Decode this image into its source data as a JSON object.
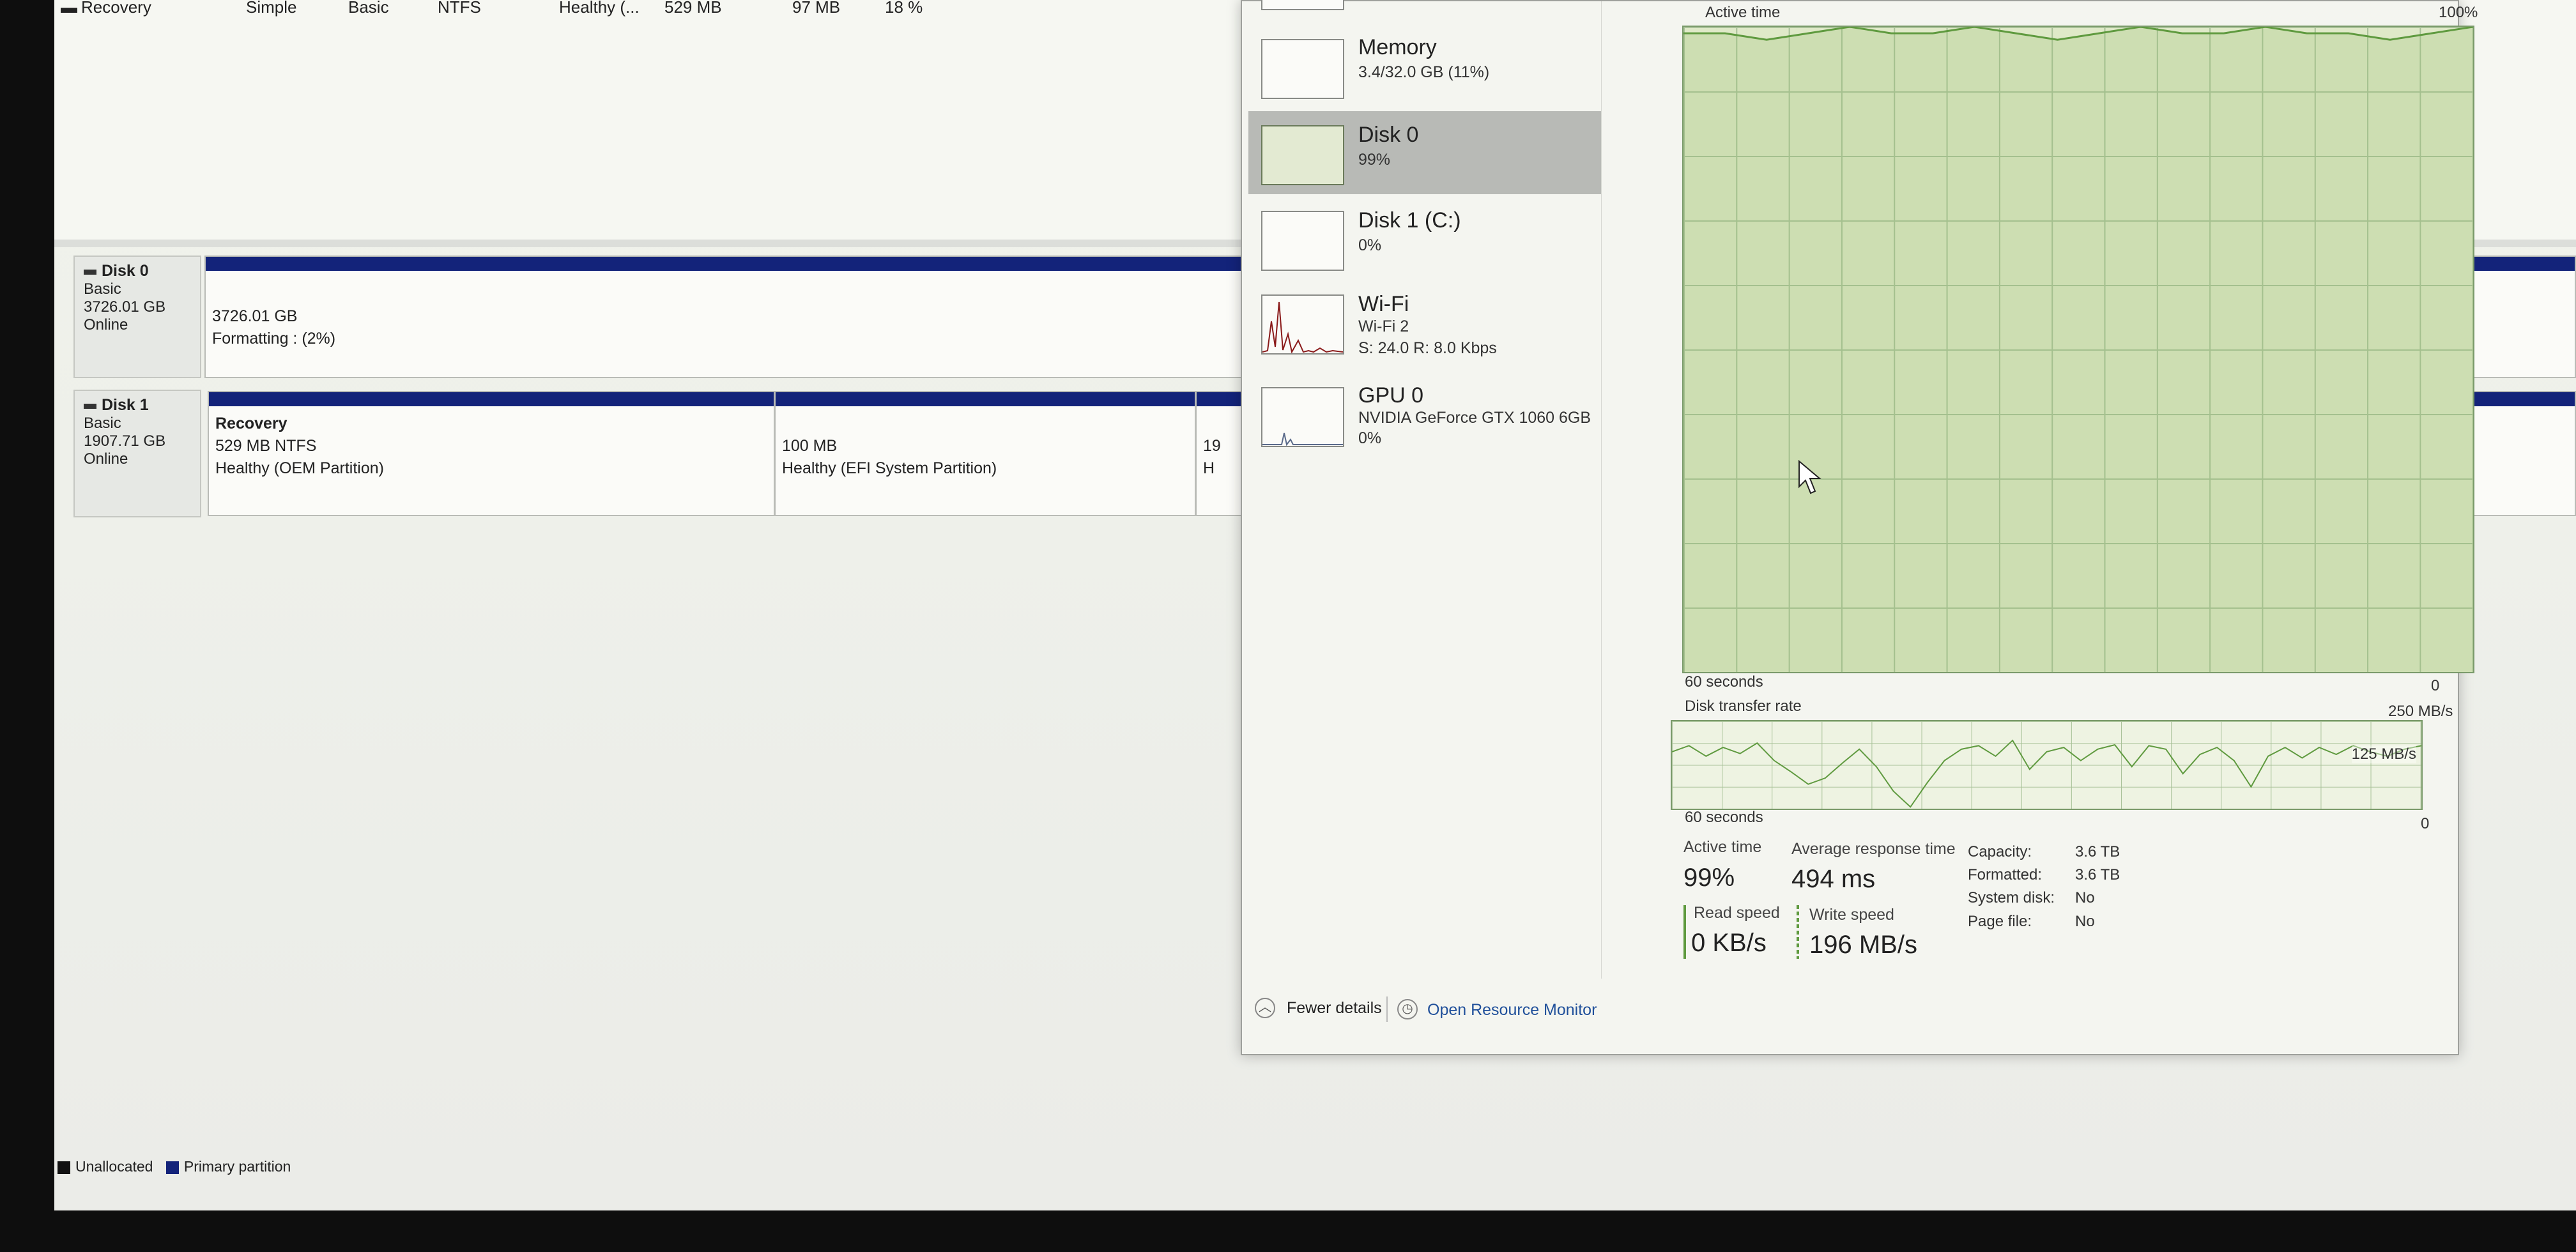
{
  "volume_row": {
    "name": "Recovery",
    "layout": "Simple",
    "type": "Basic",
    "fs": "NTFS",
    "status": "Healthy (...",
    "capacity": "529 MB",
    "free": "97 MB",
    "percent_free": "18 %"
  },
  "disks": [
    {
      "name": "Disk 0",
      "kind": "Basic",
      "size": "3726.01 GB",
      "state": "Online",
      "partition": {
        "size": "3726.01 GB",
        "status": "Formatting : (2%)"
      }
    },
    {
      "name": "Disk 1",
      "kind": "Basic",
      "size": "1907.71 GB",
      "state": "Online",
      "partitions": [
        {
          "title": "Recovery",
          "size": "529 MB NTFS",
          "status": "Healthy (OEM Partition)"
        },
        {
          "title": "",
          "size": "100 MB",
          "status": "Healthy (EFI System Partition)"
        },
        {
          "title": "",
          "size": "19",
          "status": "H"
        }
      ]
    }
  ],
  "legend": {
    "unallocated": "Unallocated",
    "primary": "Primary partition",
    "unallocated_color": "#111111",
    "primary_color": "#13237a"
  },
  "resources": [
    {
      "title": "Memory",
      "line1": "3.4/32.0 GB (11%)",
      "line2": ""
    },
    {
      "title": "Disk 0",
      "line1": "99%",
      "line2": ""
    },
    {
      "title": "Disk 1 (C:)",
      "line1": "0%",
      "line2": ""
    },
    {
      "title": "Wi-Fi",
      "line1": "Wi-Fi 2",
      "line2": "S: 24.0  R: 8.0 Kbps"
    },
    {
      "title": "GPU 0",
      "line1": "NVIDIA GeForce GTX 1060 6GB",
      "line2": "0%"
    }
  ],
  "graph": {
    "active_time_label": "Active time",
    "max_label": "100%",
    "time_left": "60 seconds",
    "time_right": "0",
    "transfer_label": "Disk transfer rate",
    "transfer_max": "250 MB/s",
    "transfer_mid": "125 MB/s",
    "transfer_time_left": "60 seconds",
    "transfer_time_right": "0",
    "transfer_line": [
      0.65,
      0.72,
      0.6,
      0.7,
      0.63,
      0.75,
      0.55,
      0.42,
      0.28,
      0.35,
      0.52,
      0.68,
      0.48,
      0.2,
      0.02,
      0.3,
      0.55,
      0.68,
      0.72,
      0.6,
      0.78,
      0.45,
      0.65,
      0.7,
      0.55,
      0.68,
      0.73,
      0.48,
      0.72,
      0.68,
      0.4,
      0.62,
      0.7,
      0.55,
      0.25,
      0.6,
      0.7,
      0.58,
      0.7,
      0.62,
      0.72,
      0.65,
      0.6,
      0.68,
      0.72
    ],
    "active_line": [
      0.99,
      0.99,
      0.98,
      0.99,
      1.0,
      0.99,
      0.99,
      1.0,
      0.99,
      0.98,
      0.99,
      1.0,
      0.99,
      0.99,
      1.0,
      0.99,
      0.99,
      0.98,
      0.99,
      1.0
    ]
  },
  "stats": {
    "active_time_label": "Active time",
    "active_time_value": "99%",
    "avg_resp_label": "Average response time",
    "avg_resp_value": "494 ms",
    "read_label": "Read speed",
    "read_value": "0 KB/s",
    "write_label": "Write speed",
    "write_value": "196 MB/s",
    "capacity_label": "Capacity:",
    "capacity_value": "3.6 TB",
    "formatted_label": "Formatted:",
    "formatted_value": "3.6 TB",
    "system_disk_label": "System disk:",
    "system_disk_value": "No",
    "page_file_label": "Page file:",
    "page_file_value": "No"
  },
  "footer": {
    "fewer_details": "Fewer details",
    "resource_monitor": "Open Resource Monitor"
  },
  "colors": {
    "graph_line": "#5f9a3f",
    "graph_fill": "#dfe9c8",
    "partition_bar": "#13237a",
    "wifi_line": "#8a1a1a",
    "selected_bg": "#b8bab6"
  }
}
